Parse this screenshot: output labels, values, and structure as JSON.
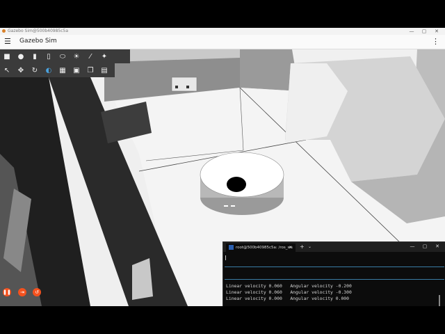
{
  "window": {
    "title": "Gazebo Sim@500b40985c5a",
    "controls": [
      "—",
      "▢",
      "✕"
    ]
  },
  "app": {
    "title": "Gazebo Sim",
    "menu_icon": "☰",
    "more_icon": "⋮"
  },
  "toolbar_shapes": [
    "box-icon",
    "sphere-icon",
    "cylinder-icon",
    "capsule-icon",
    "ellipsoid-icon",
    "sun-icon",
    "light-icon",
    "spot-light-icon"
  ],
  "toolbar_transform": [
    "select-icon",
    "translate-icon",
    "rotate-icon",
    "snap-icon",
    "grid-icon",
    "screenshot-icon",
    "copy-icon",
    "paste-icon"
  ],
  "sim_controls": {
    "play": "❚❚",
    "step": "⇥",
    "reset": "↺"
  },
  "terminal": {
    "tab_title": "root@500b40985c5a: /ros_ws",
    "tab_close": "✕",
    "new_tab": "+",
    "dropdown": "⌄",
    "controls": [
      "—",
      "▢",
      "✕"
    ],
    "lines": [
      "Linear velocity 0.060   Angular velocity -0.200",
      "Linear velocity 0.060   Angular velocity -0.300",
      "Linear velocity 0.000   Angular velocity 0.000"
    ]
  }
}
